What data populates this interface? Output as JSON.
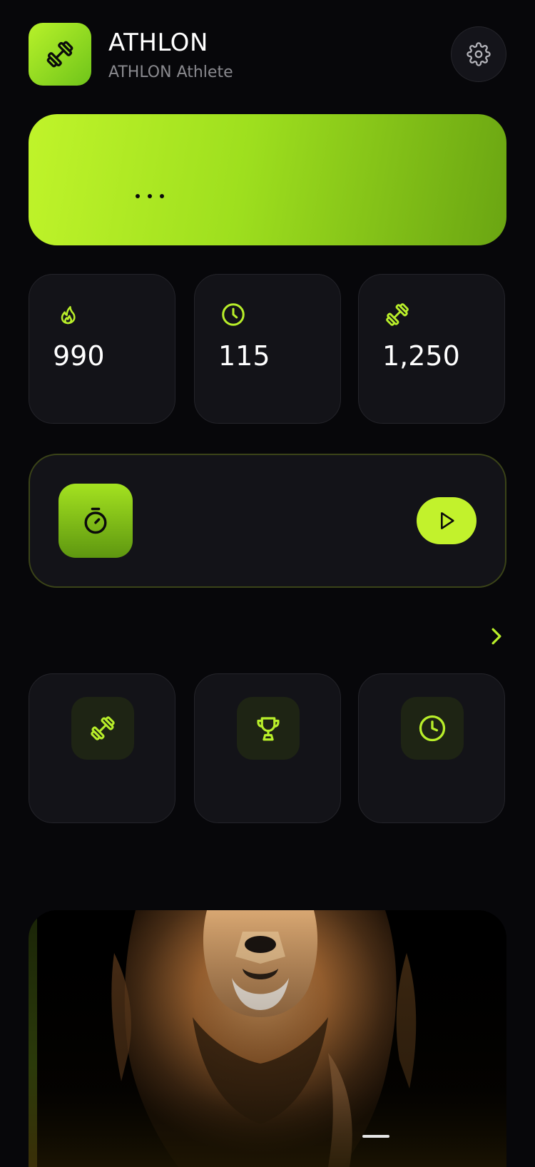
{
  "app": {
    "title": "ATHLON",
    "subtitle": "ATHLON Athlete"
  },
  "hero": {
    "text": "..."
  },
  "stats": [
    {
      "icon": "flame-icon",
      "value": "990"
    },
    {
      "icon": "clock-icon",
      "value": "115"
    },
    {
      "icon": "dumbbell-icon",
      "value": "1,250"
    }
  ],
  "workout": {
    "timer_icon": "stopwatch-icon",
    "play_icon": "play-icon"
  },
  "quick_actions": [
    {
      "icon": "dumbbell-icon"
    },
    {
      "icon": "trophy-icon"
    },
    {
      "icon": "clock-icon"
    }
  ],
  "promo": {
    "image": "lion-photo"
  },
  "colors": {
    "accent": "#c2f22c",
    "background": "#07070a",
    "card": "#131318"
  }
}
